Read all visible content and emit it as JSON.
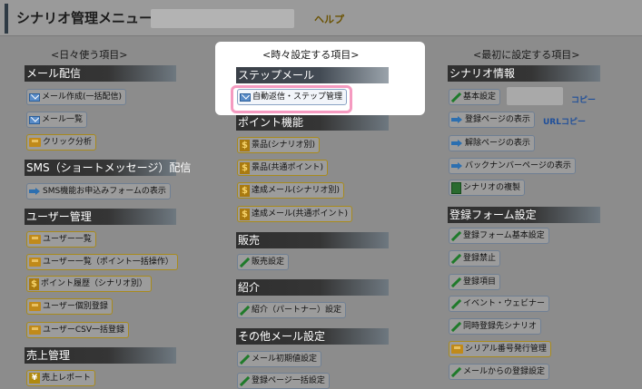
{
  "header": {
    "title": "シナリオ管理メニュー：",
    "help_label": "ヘルプ"
  },
  "columns": {
    "left": {
      "title": "<日々使う項目>",
      "sections": [
        {
          "name": "メール配信",
          "items": [
            {
              "label": "メール作成(一括配信)",
              "icon": "mail-icon"
            },
            {
              "label": "メール一覧",
              "icon": "mail-icon"
            },
            {
              "label": "クリック分析",
              "icon": "folder-icon"
            }
          ]
        },
        {
          "name": "SMS（ショートメッセージ）配信",
          "items": [
            {
              "label": "SMS機能お申込みフォームの表示",
              "icon": "arrow-icon"
            }
          ]
        },
        {
          "name": "ユーザー管理",
          "items": [
            {
              "label": "ユーザー一覧",
              "icon": "folder-icon"
            },
            {
              "label": "ユーザー一覧（ポイント一括操作）",
              "icon": "folder-icon"
            },
            {
              "label": "ポイント履歴（シナリオ別）",
              "icon": "dollar-icon"
            },
            {
              "label": "ユーザー個別登録",
              "icon": "folder-icon"
            },
            {
              "label": "ユーザーCSV一括登録",
              "icon": "folder-icon"
            }
          ]
        },
        {
          "name": "売上管理",
          "items": [
            {
              "label": "売上レポート",
              "icon": "yen-icon"
            }
          ]
        }
      ]
    },
    "middle": {
      "title": "<時々設定する項目>",
      "sections": [
        {
          "name": "ステップメール",
          "items": [
            {
              "label": "自動返信・ステップ管理",
              "icon": "mail-icon"
            }
          ]
        },
        {
          "name": "ポイント機能",
          "items": [
            {
              "label": "景品(シナリオ別)",
              "icon": "dollar-icon"
            },
            {
              "label": "景品(共通ポイント)",
              "icon": "dollar-icon"
            },
            {
              "label": "達成メール(シナリオ別)",
              "icon": "dollar-icon"
            },
            {
              "label": "達成メール(共通ポイント)",
              "icon": "dollar-icon"
            }
          ]
        },
        {
          "name": "販売",
          "items": [
            {
              "label": "販売設定",
              "icon": "pencil-icon"
            }
          ]
        },
        {
          "name": "紹介",
          "items": [
            {
              "label": "紹介（パートナー）設定",
              "icon": "pencil-icon"
            }
          ]
        },
        {
          "name": "その他メール設定",
          "items": [
            {
              "label": "メール初期値設定",
              "icon": "pencil-icon"
            },
            {
              "label": "登録ページ一括設定",
              "icon": "pencil-icon"
            }
          ]
        }
      ]
    },
    "right": {
      "title": "<最初に設定する項目>",
      "sections": [
        {
          "name": "シナリオ情報",
          "items": [
            {
              "label": "基本設定",
              "icon": "pencil-icon",
              "link": "コピー"
            },
            {
              "label": "登録ページの表示",
              "icon": "arrow-icon",
              "link": "URLコピー"
            },
            {
              "label": "解除ページの表示",
              "icon": "arrow-icon"
            },
            {
              "label": "バックナンバーページの表示",
              "icon": "arrow-icon"
            },
            {
              "label": "シナリオの複製",
              "icon": "copy-icon"
            }
          ]
        },
        {
          "name": "登録フォーム設定",
          "items": [
            {
              "label": "登録フォーム基本設定",
              "icon": "pencil-icon"
            },
            {
              "label": "登録禁止",
              "icon": "pencil-icon"
            },
            {
              "label": "登録項目",
              "icon": "pencil-icon"
            },
            {
              "label": "イベント・ウェビナー",
              "icon": "pencil-icon"
            },
            {
              "label": "同時登録先シナリオ",
              "icon": "pencil-icon"
            },
            {
              "label": "シリアル番号発行管理",
              "icon": "folder-icon"
            },
            {
              "label": "メールからの登録設定",
              "icon": "pencil-icon"
            }
          ]
        }
      ]
    }
  }
}
